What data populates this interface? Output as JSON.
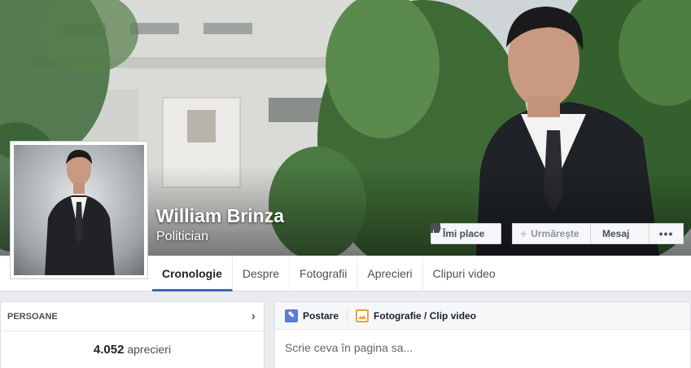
{
  "page": {
    "name": "William Brinza",
    "category": "Politician"
  },
  "actions": {
    "like_label": "Îmi place",
    "follow_label": "Urmărește",
    "message_label": "Mesaj",
    "more_label": "•••"
  },
  "tabs": [
    {
      "label": "Cronologie",
      "active": true
    },
    {
      "label": "Despre",
      "active": false
    },
    {
      "label": "Fotografii",
      "active": false
    },
    {
      "label": "Aprecieri",
      "active": false
    },
    {
      "label": "Clipuri video",
      "active": false
    }
  ],
  "people": {
    "title": "PERSOANE",
    "likes_count": "4.052",
    "likes_label": "aprecieri"
  },
  "composer": {
    "post_tab": "Postare",
    "photo_tab": "Fotografie / Clip video",
    "placeholder": "Scrie ceva în pagina sa..."
  },
  "colors": {
    "accent": "#4267b2",
    "post_icon": "#5b7bd5",
    "photo_icon": "#e8a33d"
  }
}
